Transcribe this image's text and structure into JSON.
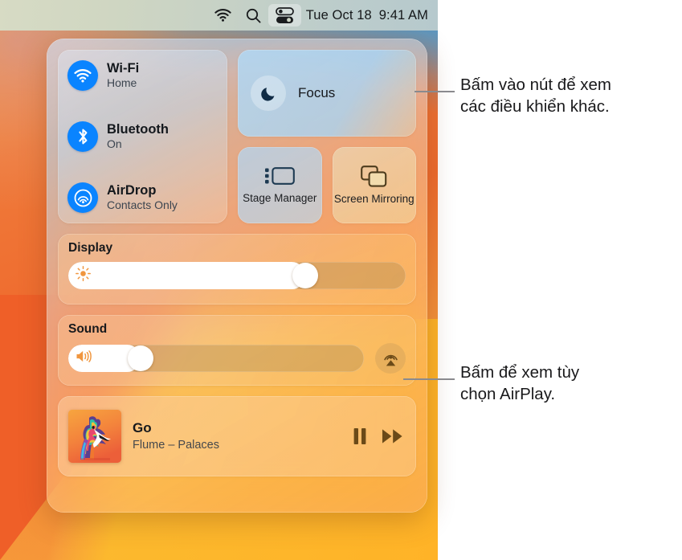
{
  "menubar": {
    "icons": [
      {
        "name": "wifi-icon",
        "label": "Wi-Fi"
      },
      {
        "name": "search-icon",
        "label": "Spotlight Search"
      },
      {
        "name": "control-center-icon",
        "label": "Control Center"
      }
    ],
    "date": "Tue Oct 18",
    "time": "9:41 AM"
  },
  "control_center": {
    "connectivity": [
      {
        "icon": "wifi-icon",
        "title": "Wi-Fi",
        "subtitle": "Home"
      },
      {
        "icon": "bluetooth-icon",
        "title": "Bluetooth",
        "subtitle": "On"
      },
      {
        "icon": "airdrop-icon",
        "title": "AirDrop",
        "subtitle": "Contacts Only"
      }
    ],
    "focus": {
      "icon": "moon-icon",
      "label": "Focus"
    },
    "mini_tiles": [
      {
        "icon": "stage-manager-icon",
        "label": "Stage\nManager"
      },
      {
        "icon": "screen-mirroring-icon",
        "label": "Screen\nMirroring"
      }
    ],
    "display": {
      "title": "Display",
      "icon": "brightness-icon",
      "value": 72
    },
    "sound": {
      "title": "Sound",
      "icon": "volume-icon",
      "value": 22,
      "airplay_icon": "airplay-audio-icon"
    },
    "now_playing": {
      "album_art": "album-art-bird",
      "title": "Go",
      "subtitle": "Flume – Palaces",
      "pause_icon": "pause-icon",
      "next_icon": "fast-forward-icon"
    }
  },
  "callouts": [
    {
      "name": "callout-control-center",
      "text": "Bấm vào nút để xem\ncác điều khiển khác."
    },
    {
      "name": "callout-airplay",
      "text": "Bấm để xem tùy\nchọn AirPlay."
    }
  ],
  "colors": {
    "accent_blue": "#0a84ff",
    "menubar": "#cdd5c5",
    "wallpaper_orange": "#ef7a3a",
    "wallpaper_yellow": "#fbb03b"
  }
}
